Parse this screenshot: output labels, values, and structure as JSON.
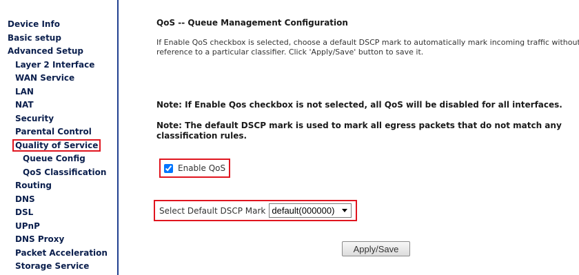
{
  "sidebar": {
    "items": [
      {
        "label": "Device Info",
        "level": 0
      },
      {
        "label": "Basic setup",
        "level": 0
      },
      {
        "label": "Advanced Setup",
        "level": 0
      },
      {
        "label": "Layer 2 Interface",
        "level": 1
      },
      {
        "label": "WAN Service",
        "level": 1
      },
      {
        "label": "LAN",
        "level": 1
      },
      {
        "label": "NAT",
        "level": 1
      },
      {
        "label": "Security",
        "level": 1
      },
      {
        "label": "Parental Control",
        "level": 1
      },
      {
        "label": "Quality of Service",
        "level": 1,
        "highlighted": true
      },
      {
        "label": "Queue Config",
        "level": 2
      },
      {
        "label": "QoS Classification",
        "level": 2
      },
      {
        "label": "Routing",
        "level": 1
      },
      {
        "label": "DNS",
        "level": 1
      },
      {
        "label": "DSL",
        "level": 1
      },
      {
        "label": "UPnP",
        "level": 1
      },
      {
        "label": "DNS Proxy",
        "level": 1
      },
      {
        "label": "Packet Acceleration",
        "level": 1
      },
      {
        "label": "Storage Service",
        "level": 1
      }
    ]
  },
  "main": {
    "title": "QoS -- Queue Management Configuration",
    "description": "If Enable QoS checkbox is selected, choose a default DSCP mark to automatically mark incoming traffic without reference to a particular classifier. Click 'Apply/Save' button to save it.",
    "note_disabled": "Note: If Enable Qos checkbox is not selected, all QoS will be disabled for all interfaces.",
    "note_default": "Note: The default DSCP mark is used to mark all egress packets that do not match any classification rules.",
    "enable_qos_label": "Enable QoS",
    "enable_qos_checked": true,
    "dscp_label": "Select Default DSCP Mark",
    "dscp_value": "default(000000)",
    "apply_label": "Apply/Save"
  },
  "colors": {
    "highlight": "#e0141e",
    "sidebar_border": "#1f3f8f",
    "nav_text": "#0b1f4d"
  },
  "icons": {
    "select_arrow": "chevron-down-icon"
  }
}
